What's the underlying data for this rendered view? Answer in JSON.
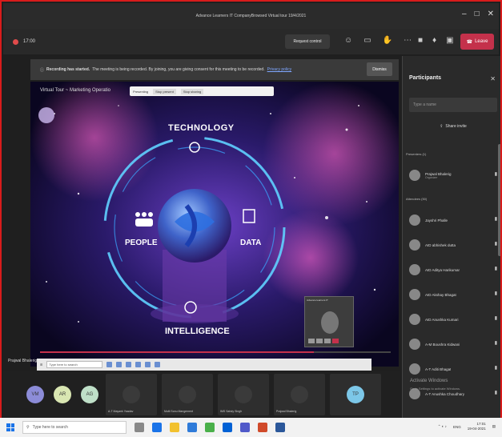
{
  "window": {
    "title": "Advance Learners IT CompanyBrowsed Virtual tour 19/4/2021"
  },
  "meeting": {
    "timer": "17:00",
    "request_control": "Request control",
    "leave": "Leave",
    "colors": {
      "leave": "#c4314b",
      "record": "#e04b4b"
    }
  },
  "banner": {
    "title": "Recording has started.",
    "message": "The meeting is being recorded. By joining, you are giving consent for this meeting to be recorded.",
    "link": "Privacy policy",
    "dismiss": "Dismiss"
  },
  "stage": {
    "title": "Virtual Tour ~ Marketing Operatio",
    "toolbar_label": "Presenting",
    "toolbar_status": "Stop present",
    "toolbar_action": "Stop sharing",
    "progress_fraction": 0.78,
    "labels": {
      "top": "TECHNOLOGY",
      "left": "PEOPLE",
      "right": "DATA",
      "bottom": "INTELLIGENCE"
    },
    "mini_video_name": "Advance learners IT"
  },
  "presenter": "Prajwal Bhalerig",
  "inner_taskbar": {
    "search": "Type here to search"
  },
  "strip": [
    {
      "initials": "VM",
      "name": "",
      "color": "#8c8cd8"
    },
    {
      "initials": "AR",
      "name": "",
      "color": "#d9e6b2"
    },
    {
      "initials": "AG",
      "name": "",
      "color": "#bfe0c8"
    },
    {
      "initials": "",
      "name": "A-T Mayank Yaadav",
      "color": "#3a3a3a"
    },
    {
      "initials": "",
      "name": "Multi Sonu Mangement",
      "color": "#3a3a3a"
    },
    {
      "initials": "",
      "name": "IMS Sahdy Singh",
      "color": "#3a3a3a"
    },
    {
      "initials": "",
      "name": "Prajwal Bhalerig",
      "color": "#3a3a3a"
    },
    {
      "initials": "TP",
      "name": "",
      "color": "#7cc7e8"
    }
  ],
  "participants": {
    "title": "Participants",
    "search_placeholder": "Type a name",
    "share_invite": "Share invite",
    "presenters_label": "Presenters (1)",
    "attendees_label": "Attendees (50)",
    "presenter": {
      "name": "Prajwal Bhalerig",
      "role": "Organizer"
    },
    "attendees": [
      "Jayshri Phalle",
      "AID abhishek dutta",
      "AID Aditya Harikumar",
      "AID Akshay Bhagat",
      "AID Anushka Kumari",
      "A-M Boushra Kidwani",
      "A-T Aditi Bhagat",
      "A-T Anushka Choudhary"
    ]
  },
  "watermark": {
    "line1": "Activate Windows",
    "line2": "Go to Settings to activate Windows."
  },
  "os_taskbar": {
    "search": "Type here to search",
    "lang": "ENG",
    "time": "17:01",
    "date": "19-04-2021"
  }
}
